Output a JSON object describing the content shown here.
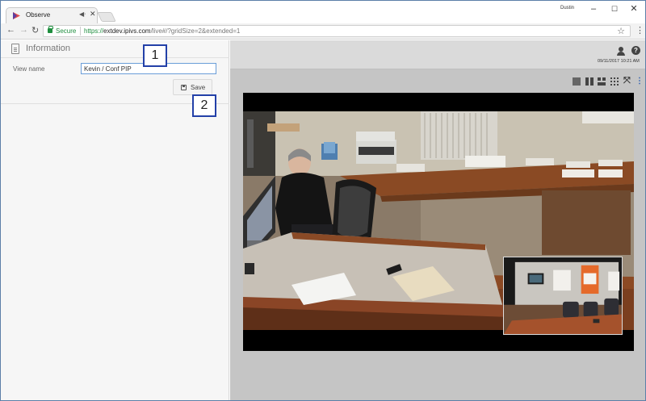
{
  "browser": {
    "tab_title": "Observe",
    "audio_icon": "speaker-icon",
    "close_icon": "close-icon",
    "profile_name": "Dustin",
    "window_controls": {
      "minimize": "–",
      "maximize": "☐",
      "close": "✕"
    }
  },
  "toolbar": {
    "back": "←",
    "forward": "→",
    "reload": "↻",
    "secure_label": "Secure",
    "url_scheme": "https://",
    "url_host": "extdev.ipivs.com",
    "url_path": "/live#/?gridSize=2&extended=1",
    "bookmark_icon": "☆",
    "menu_icon": "⋮"
  },
  "panel": {
    "title": "Information",
    "view_name_label": "View name",
    "view_name_value": "Kevin / Conf PIP",
    "save_label": "Save"
  },
  "callouts": {
    "one": "1",
    "two": "2"
  },
  "header": {
    "timestamp": "09/11/2017 10:21 AM",
    "help_glyph": "?"
  },
  "layout_toolbar": {
    "expand_glyph": "⤧",
    "more_glyph": "⋮"
  },
  "colors": {
    "callout_border": "#2340a8",
    "secure_green": "#1e8e3e",
    "accent_blue": "#2a5db0"
  }
}
